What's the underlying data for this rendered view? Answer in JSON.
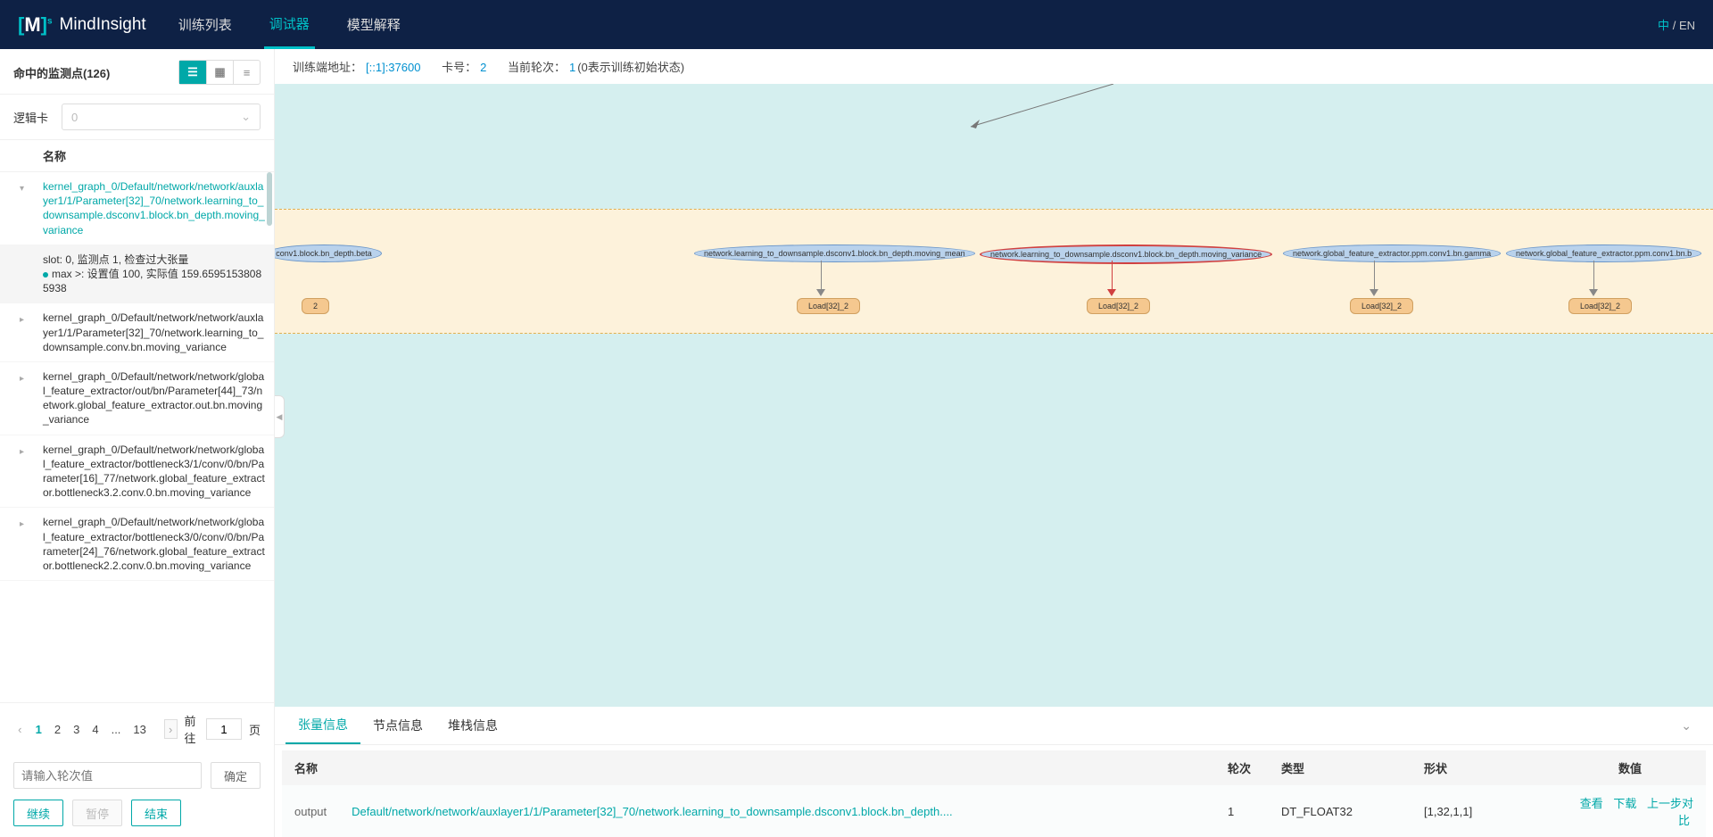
{
  "brand": "MindInsight",
  "nav": {
    "trainlist": "训练列表",
    "debugger": "调试器",
    "explain": "模型解释"
  },
  "lang": {
    "zh": "中",
    "sep": "/",
    "en": "EN"
  },
  "sidebar": {
    "title": "命中的监测点(126)",
    "lk_label": "逻辑卡",
    "lk_value": "0",
    "col_name": "名称",
    "items": [
      {
        "txt": "kernel_graph_0/Default/network/network/auxlayer1/1/Parameter[32]_70/network.learning_to_downsample.dsconv1.block.bn_depth.moving_variance",
        "sel": true,
        "caret": "▾"
      },
      {
        "txt": "slot: 0, 监测点 1, 检查过大张量\nmax >: 设置值 100, 实际值 159.65951538085938",
        "slot": true
      },
      {
        "txt": "kernel_graph_0/Default/network/network/auxlayer1/1/Parameter[32]_70/network.learning_to_downsample.conv.bn.moving_variance",
        "caret": "▸"
      },
      {
        "txt": "kernel_graph_0/Default/network/network/global_feature_extractor/out/bn/Parameter[44]_73/network.global_feature_extractor.out.bn.moving_variance",
        "caret": "▸"
      },
      {
        "txt": "kernel_graph_0/Default/network/network/global_feature_extractor/bottleneck3/1/conv/0/bn/Parameter[16]_77/network.global_feature_extractor.bottleneck3.2.conv.0.bn.moving_variance",
        "caret": "▸"
      },
      {
        "txt": "kernel_graph_0/Default/network/network/global_feature_extractor/bottleneck3/0/conv/0/bn/Parameter[24]_76/network.global_feature_extractor.bottleneck2.2.conv.0.bn.moving_variance",
        "caret": "▸"
      }
    ],
    "pager": {
      "pages": [
        "1",
        "2",
        "3",
        "4",
        "...",
        "13"
      ],
      "goto_lbl": "前往",
      "goto_val": "1",
      "page_suf": "页"
    },
    "step_ph": "请输入轮次值",
    "ok": "确定",
    "continue": "继续",
    "pause": "暂停",
    "end": "结束"
  },
  "infobar": {
    "addr_lbl": "训练端地址：",
    "addr": "[::1]:37600",
    "card_lbl": "卡号：",
    "card": "2",
    "round_lbl": "当前轮次：",
    "round": "1",
    "round_note": "(0表示训练初始状态)"
  },
  "graph": {
    "n0": "conv1.block.bn_depth.beta",
    "n1": "network.learning_to_downsample.dsconv1.block.bn_depth.moving_mean",
    "n2": "network.learning_to_downsample.dsconv1.block.bn_depth.moving_variance",
    "n3": "network.global_feature_extractor.ppm.conv1.bn.gamma",
    "n4": "network.global_feature_extractor.ppm.conv1.bn.b",
    "load": "Load[32]_2",
    "cut": "2"
  },
  "tabs": {
    "tensor": "张量信息",
    "node": "节点信息",
    "stack": "堆栈信息"
  },
  "table": {
    "cols": {
      "name": "名称",
      "round": "轮次",
      "type": "类型",
      "shape": "形状",
      "value": "数值"
    },
    "row": {
      "out": "output",
      "path": "Default/network/network/auxlayer1/1/Parameter[32]_70/network.learning_to_downsample.dsconv1.block.bn_depth....",
      "round": "1",
      "type": "DT_FLOAT32",
      "shape": "[1,32,1,1]",
      "view": "查看",
      "download": "下载",
      "compare": "上一步对比"
    }
  }
}
